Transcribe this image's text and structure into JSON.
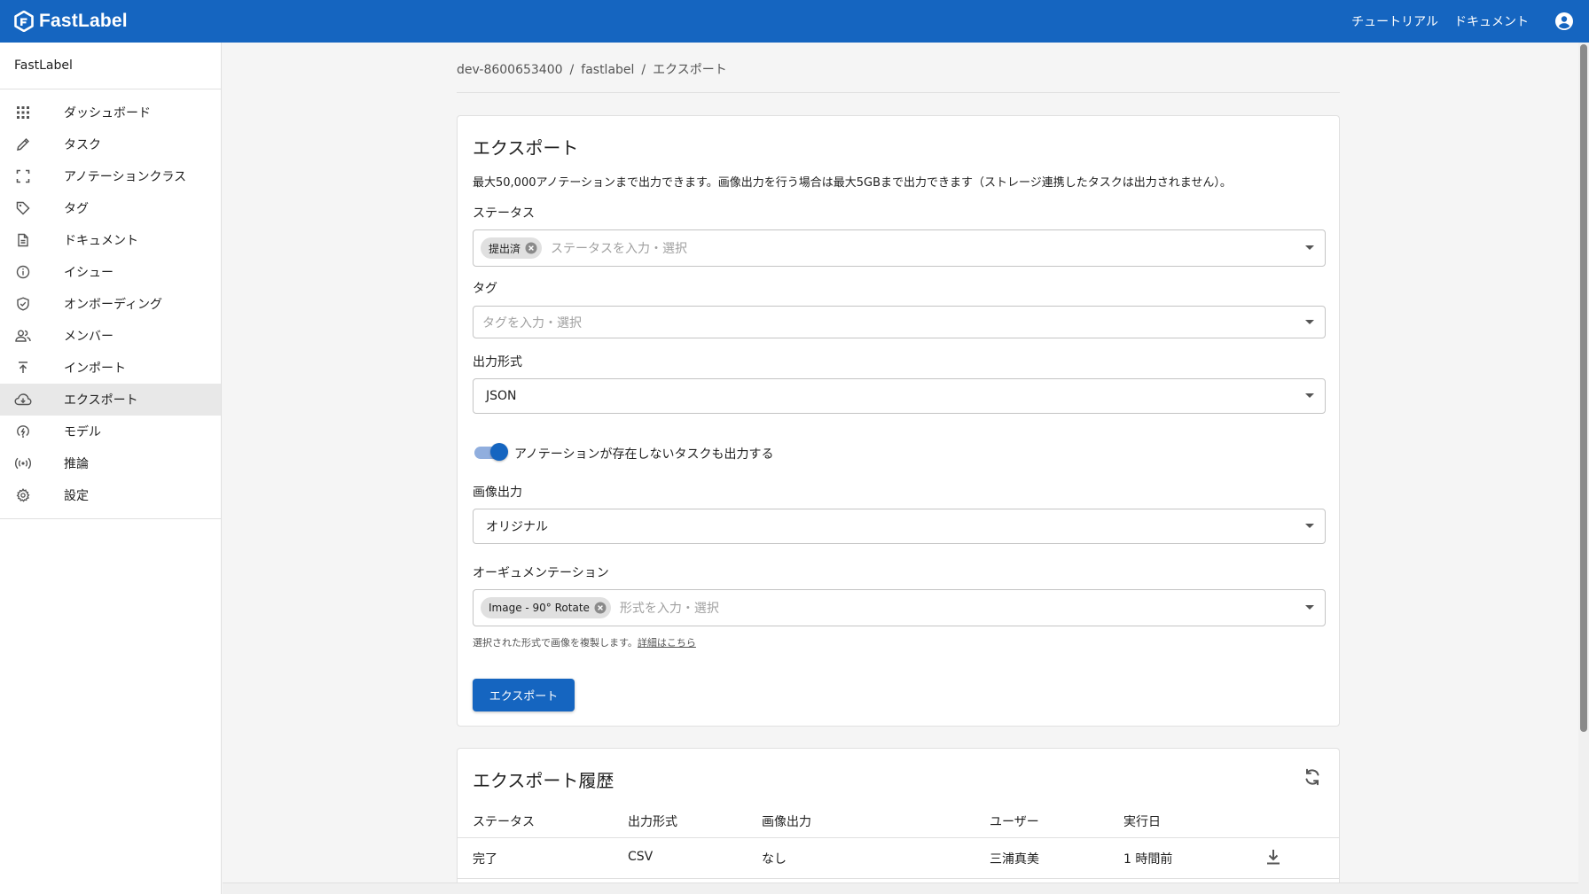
{
  "appbar": {
    "logo_text": "FastLabel",
    "links": [
      "チュートリアル",
      "ドキュメント"
    ],
    "color": "#1565c0"
  },
  "sidebar": {
    "org": "FastLabel",
    "items": [
      {
        "label": "ダッシュボード",
        "icon": "apps-grid-icon"
      },
      {
        "label": "タスク",
        "icon": "pencil-icon"
      },
      {
        "label": "アノテーションクラス",
        "icon": "frame-corners-icon"
      },
      {
        "label": "タグ",
        "icon": "tag-icon"
      },
      {
        "label": "ドキュメント",
        "icon": "document-icon"
      },
      {
        "label": "イシュー",
        "icon": "info-icon"
      },
      {
        "label": "オンボーディング",
        "icon": "shield-check-icon"
      },
      {
        "label": "メンバー",
        "icon": "people-icon"
      },
      {
        "label": "インポート",
        "icon": "upload-icon"
      },
      {
        "label": "エクスポート",
        "icon": "cloud-download-icon",
        "active": true
      },
      {
        "label": "モデル",
        "icon": "model-icon"
      },
      {
        "label": "推論",
        "icon": "broadcast-icon"
      },
      {
        "label": "設定",
        "icon": "gear-icon"
      }
    ]
  },
  "breadcrumb": [
    "dev-8600653400",
    "fastlabel",
    "エクスポート"
  ],
  "export_form": {
    "title": "エクスポート",
    "description": "最大50,000アノテーションまで出力できます。画像出力を行う場合は最大5GBまで出力できます（ストレージ連携したタスクは出力されません）。",
    "status": {
      "label": "ステータス",
      "chip": "提出済",
      "placeholder": "ステータスを入力・選択"
    },
    "tag": {
      "label": "タグ",
      "placeholder": "タグを入力・選択"
    },
    "format": {
      "label": "出力形式",
      "value": "JSON"
    },
    "toggle": {
      "label": "アノテーションが存在しないタスクも出力する",
      "checked": true
    },
    "image_output": {
      "label": "画像出力",
      "value": "オリジナル"
    },
    "augmentation": {
      "label": "オーギュメンテーション",
      "chip": "Image - 90° Rotate",
      "placeholder": "形式を入力・選択",
      "helper": "選択された形式で画像を複製します。",
      "helper_link": "詳細はこちら"
    },
    "button": "エクスポート"
  },
  "history": {
    "title": "エクスポート履歴",
    "columns": [
      "ステータス",
      "出力形式",
      "画像出力",
      "ユーザー",
      "実行日"
    ],
    "rows": [
      {
        "status": "完了",
        "format": "CSV",
        "image_output": "なし",
        "user": "三浦真美",
        "date": "1 時間前"
      }
    ]
  }
}
